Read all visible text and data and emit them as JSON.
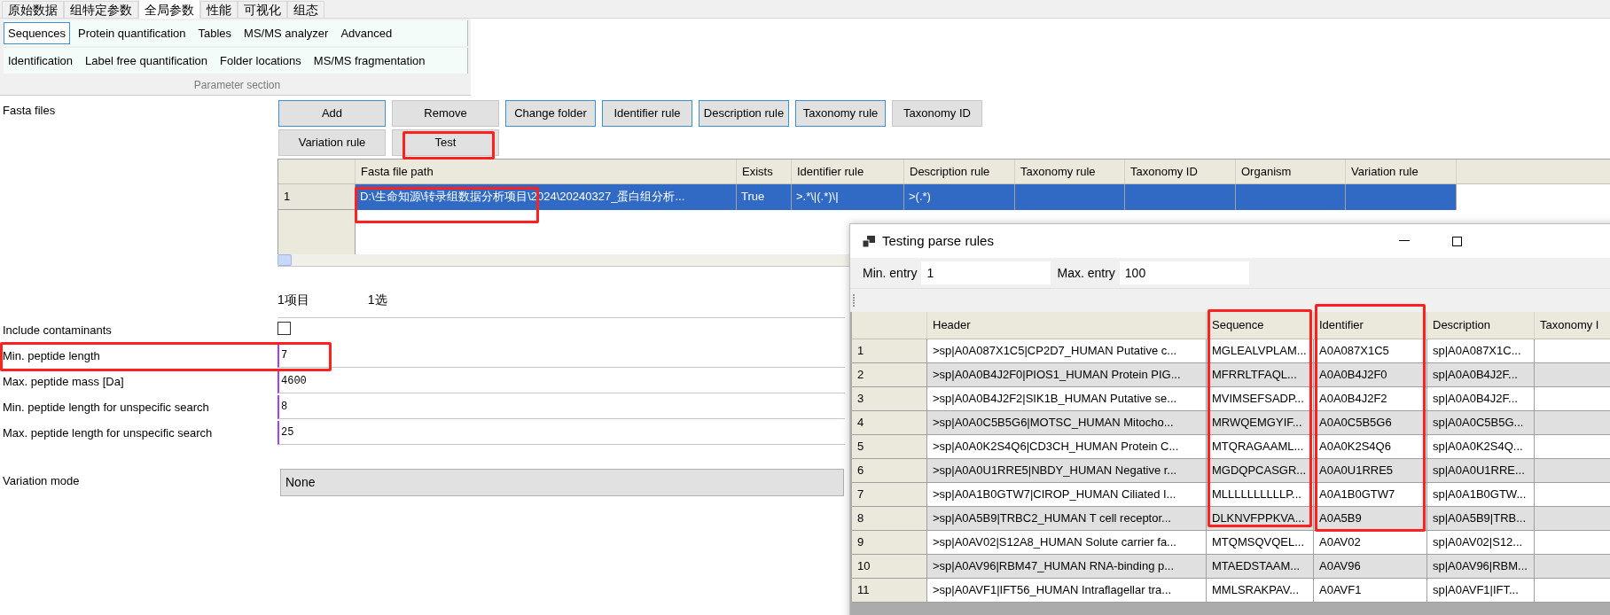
{
  "top_tabs": [
    {
      "label": "原始数据",
      "selected": false
    },
    {
      "label": "组特定参数",
      "selected": false
    },
    {
      "label": "全局参数",
      "selected": true
    },
    {
      "label": "性能",
      "selected": false
    },
    {
      "label": "可视化",
      "selected": false
    },
    {
      "label": "组态",
      "selected": false
    }
  ],
  "parameter_section": {
    "title": "Parameter section",
    "rows": [
      [
        {
          "label": "Sequences",
          "selected": true
        },
        {
          "label": "Protein quantification",
          "selected": false
        },
        {
          "label": "Tables",
          "selected": false
        },
        {
          "label": "MS/MS analyzer",
          "selected": false
        },
        {
          "label": "Advanced",
          "selected": false
        }
      ],
      [
        {
          "label": "Identification",
          "selected": false
        },
        {
          "label": "Label free quantification",
          "selected": false
        },
        {
          "label": "Folder locations",
          "selected": false
        },
        {
          "label": "MS/MS fragmentation",
          "selected": false
        }
      ]
    ]
  },
  "fasta_files": {
    "label": "Fasta files",
    "button_rows": [
      [
        {
          "label": "Add",
          "outlined": true
        },
        {
          "label": "Remove",
          "outlined": false
        },
        {
          "label": "Change folder",
          "outlined": true
        },
        {
          "label": "Identifier rule",
          "outlined": true
        },
        {
          "label": "Description rule",
          "outlined": true
        },
        {
          "label": "Taxonomy rule",
          "outlined": true
        },
        {
          "label": "Taxonomy ID",
          "outlined": false
        }
      ],
      [
        {
          "label": "Variation rule",
          "outlined": false
        },
        {
          "label": "Test",
          "outlined": false
        }
      ]
    ],
    "table": {
      "columns": [
        "Fasta file path",
        "Exists",
        "Identifier rule",
        "Description rule",
        "Taxonomy rule",
        "Taxonomy ID",
        "Organism",
        "Variation rule"
      ],
      "rows": [
        {
          "number": "1",
          "selected": true,
          "cells": [
            "D:\\生命知源\\转录组数据分析项目\\2024\\20240327_蛋白组分析...",
            "True",
            ">.*\\|(.*)\\|",
            ">(.*)"
          ]
        }
      ]
    },
    "status": [
      "1项目",
      "1选"
    ]
  },
  "parameters": [
    {
      "kind": "checkbox",
      "label": "Include contaminants",
      "checked": false
    },
    {
      "kind": "text",
      "label": "Min. peptide length",
      "value": "7"
    },
    {
      "kind": "text",
      "label": "Max. peptide mass [Da]",
      "value": "4600"
    },
    {
      "kind": "text",
      "label": "Min. peptide length for unspecific search",
      "value": "8"
    },
    {
      "kind": "text",
      "label": "Max. peptide length for unspecific search",
      "value": "25"
    },
    {
      "kind": "dropdown",
      "label": "Variation mode",
      "value": "None"
    }
  ],
  "dialog": {
    "title": "Testing parse rules",
    "min_entry": {
      "label": "Min. entry",
      "value": "1"
    },
    "max_entry": {
      "label": "Max. entry",
      "value": "100"
    },
    "table": {
      "columns": [
        "Header",
        "Sequence",
        "Identifier",
        "Description",
        "Taxonomy I"
      ],
      "rows": [
        {
          "number": "1",
          "cells": [
            ">sp|A0A087X1C5|CP2D7_HUMAN Putative c...",
            "MGLEALVPLAM...",
            "A0A087X1C5",
            "sp|A0A087X1C..."
          ]
        },
        {
          "number": "2",
          "cells": [
            ">sp|A0A0B4J2F0|PIOS1_HUMAN Protein PIG...",
            "MFRRLTFAQL...",
            "A0A0B4J2F0",
            "sp|A0A0B4J2F..."
          ]
        },
        {
          "number": "3",
          "cells": [
            ">sp|A0A0B4J2F2|SIK1B_HUMAN Putative se...",
            "MVIMSEFSADP...",
            "A0A0B4J2F2",
            "sp|A0A0B4J2F..."
          ]
        },
        {
          "number": "4",
          "cells": [
            ">sp|A0A0C5B5G6|MOTSC_HUMAN Mitocho...",
            "MRWQEMGYIF...",
            "A0A0C5B5G6",
            "sp|A0A0C5B5G..."
          ]
        },
        {
          "number": "5",
          "cells": [
            ">sp|A0A0K2S4Q6|CD3CH_HUMAN Protein C...",
            "MTQRAGAAML...",
            "A0A0K2S4Q6",
            "sp|A0A0K2S4Q..."
          ]
        },
        {
          "number": "6",
          "cells": [
            ">sp|A0A0U1RRE5|NBDY_HUMAN Negative r...",
            "MGDQPCASGR...",
            "A0A0U1RRE5",
            "sp|A0A0U1RRE..."
          ]
        },
        {
          "number": "7",
          "cells": [
            ">sp|A0A1B0GTW7|CIROP_HUMAN Ciliated I...",
            "MLLLLLLLLLLP...",
            "A0A1B0GTW7",
            "sp|A0A1B0GTW..."
          ]
        },
        {
          "number": "8",
          "cells": [
            ">sp|A0A5B9|TRBC2_HUMAN T cell receptor...",
            "DLKNVFPPKVA...",
            "A0A5B9",
            "sp|A0A5B9|TRB..."
          ]
        },
        {
          "number": "9",
          "cells": [
            ">sp|A0AV02|S12A8_HUMAN Solute carrier fa...",
            "MTQMSQVQEL...",
            "A0AV02",
            "sp|A0AV02|S12..."
          ]
        },
        {
          "number": "10",
          "cells": [
            ">sp|A0AV96|RBM47_HUMAN RNA-binding p...",
            "MTAEDSTAAM...",
            "A0AV96",
            "sp|A0AV96|RBM..."
          ]
        },
        {
          "number": "11",
          "cells": [
            ">sp|A0AVF1|IFT56_HUMAN Intraflagellar tra...",
            "MMLSRAKPAV...",
            "A0AVF1",
            "sp|A0AVF1|IFT..."
          ]
        }
      ]
    }
  }
}
